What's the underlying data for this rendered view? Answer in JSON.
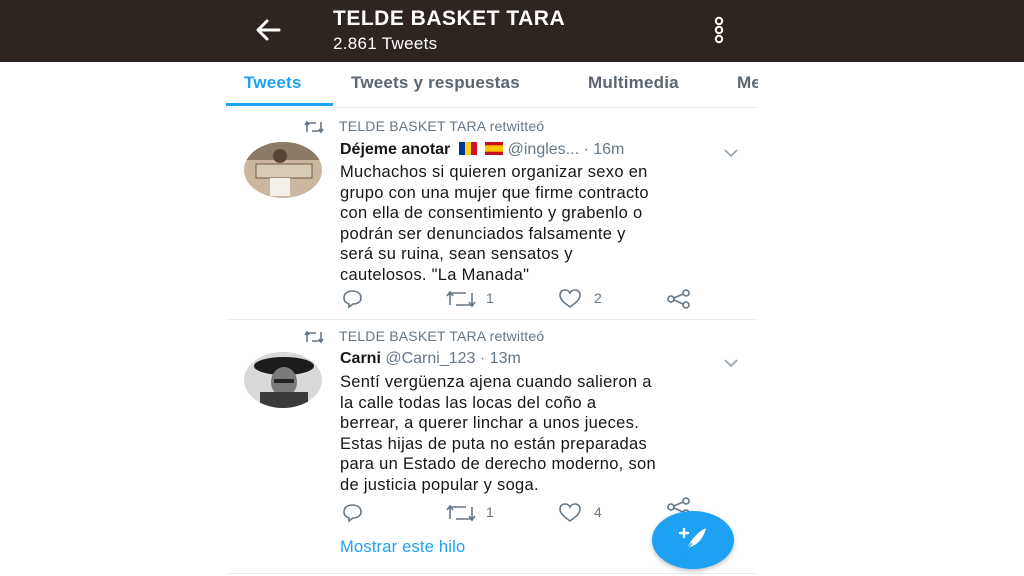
{
  "header": {
    "back_icon": "arrow-left-icon",
    "title": "TELDE BASKET TARA",
    "subtitle": "2.861 Tweets",
    "more_icon": "vertical-dots-icon"
  },
  "tabs": [
    {
      "label": "Tweets",
      "active": true
    },
    {
      "label": "Tweets y respuestas",
      "active": false
    },
    {
      "label": "Multimedia",
      "active": false
    },
    {
      "label": "Me",
      "active": false
    }
  ],
  "tweets": [
    {
      "retweet_label": "TELDE BASKET TARA retwitteó",
      "name": "Déjeme anotar",
      "handle": "@ingles...",
      "time": "· 16m",
      "text": "Muchachos si quieren organizar sexo en\ngrupo con una mujer que firme contracto\ncon ella  de consentimiento y grabenlo o\npodrán ser denunciados falsamente y\nserá su ruina, sean sensatos y\ncautelosos.  \"La Manada\"",
      "retweets": "1",
      "likes": "2"
    },
    {
      "retweet_label": "TELDE BASKET TARA retwitteó",
      "name": "Carni",
      "handle": "@Carni_123",
      "time": "· 13m",
      "text": "Sentí vergüenza ajena cuando salieron a\nla calle todas las locas del coño a\nberrear, a querer linchar a unos jueces.\nEstas hijas de puta no están preparadas\npara un Estado de derecho moderno, son\nde justicia popular y soga.",
      "retweets": "1",
      "likes": "4",
      "show_thread": "Mostrar este hilo"
    }
  ],
  "colors": {
    "header_bg": "#2e2520",
    "accent": "#1da1f2",
    "muted": "#657786"
  },
  "fab_icon": "compose-feather-icon"
}
